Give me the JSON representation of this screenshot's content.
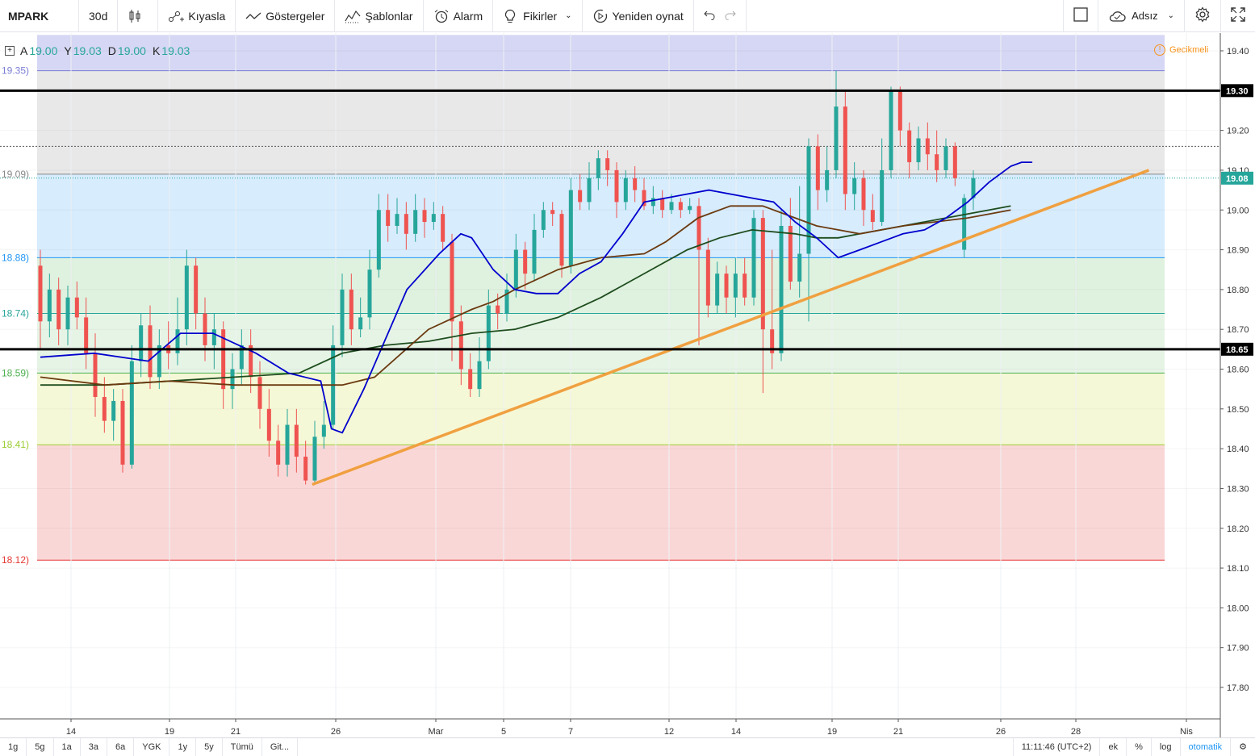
{
  "toolbar": {
    "symbol": "MPARK",
    "interval": "30d",
    "compare": "Kıyasla",
    "indicators": "Göstergeler",
    "templates": "Şablonlar",
    "alarm": "Alarm",
    "ideas": "Fikirler",
    "replay": "Yeniden oynat",
    "layout_name": "Adsız"
  },
  "legend": {
    "open_label": "A",
    "open": "19.00",
    "high_label": "Y",
    "high": "19.03",
    "low_label": "D",
    "low": "19.00",
    "close_label": "K",
    "close": "19.03",
    "delay": "Gecikmeli"
  },
  "bottombar": {
    "ranges": [
      "1g",
      "5g",
      "1a",
      "3a",
      "6a",
      "YGK",
      "1y",
      "5y",
      "Tümü",
      "Git..."
    ],
    "clock": "11:11:46 (UTC+2)",
    "toggles": [
      "ek",
      "%",
      "log",
      "otomatik"
    ]
  },
  "colors": {
    "up": "#26a69a",
    "down": "#ef5350",
    "ma_fast": "#0000cd",
    "ma_mid": "#6b3a10",
    "ma_slow": "#1e4d1e",
    "trendline": "#f0a040",
    "accent": "#2196f3"
  },
  "chart_data": {
    "type": "candlestick",
    "price_axis": {
      "ticks": [
        "19.40",
        "19.30",
        "19.20",
        "19.10",
        "19.00",
        "18.90",
        "18.80",
        "18.70",
        "18.60",
        "18.50",
        "18.40",
        "18.30",
        "18.20",
        "18.10",
        "18.00",
        "17.90",
        "17.80"
      ],
      "range": [
        17.75,
        19.45
      ]
    },
    "time_axis": {
      "ticks": [
        "14",
        "19",
        "21",
        "26",
        "Mar",
        "5",
        "7",
        "12",
        "14",
        "19",
        "21",
        "26",
        "28",
        "Nis"
      ]
    },
    "fib_levels": [
      {
        "label": "19.35)",
        "value": 19.35,
        "fill": "rgba(120,123,220,0.30)"
      },
      {
        "label": "19.09)",
        "value": 19.09,
        "fill": "rgba(150,150,150,0.22)"
      },
      {
        "label": "18.88)",
        "value": 18.88,
        "fill": "rgba(33,150,243,0.18)"
      },
      {
        "label": "18.74)",
        "value": 18.74,
        "fill": "rgba(76,175,80,0.18)"
      },
      {
        "label": "18.59)",
        "value": 18.59,
        "fill": "rgba(129,199,132,0.20)"
      },
      {
        "label": "18.41)",
        "value": 18.41,
        "fill": "rgba(205,220,57,0.20)"
      },
      {
        "label": "18.12)",
        "value": 18.12,
        "fill": "rgba(229,57,53,0.20)"
      }
    ],
    "fib_top": 19.44,
    "horizontal_lines": [
      {
        "value": 19.3,
        "label": "19.30"
      },
      {
        "value": 18.65,
        "label": "18.65"
      }
    ],
    "dotted_line": 19.16,
    "last_price": {
      "value": 19.08,
      "label": "19.08"
    },
    "trendline": {
      "from": [
        0.244,
        18.31
      ],
      "to": [
        0.986,
        19.1
      ]
    },
    "ma_fast": [
      [
        0.0,
        18.63
      ],
      [
        0.05,
        18.64
      ],
      [
        0.1,
        18.62
      ],
      [
        0.13,
        18.69
      ],
      [
        0.16,
        18.69
      ],
      [
        0.2,
        18.64
      ],
      [
        0.23,
        18.59
      ],
      [
        0.26,
        18.57
      ],
      [
        0.27,
        18.45
      ],
      [
        0.28,
        18.44
      ],
      [
        0.3,
        18.55
      ],
      [
        0.34,
        18.8
      ],
      [
        0.37,
        18.89
      ],
      [
        0.39,
        18.94
      ],
      [
        0.4,
        18.93
      ],
      [
        0.42,
        18.85
      ],
      [
        0.44,
        18.8
      ],
      [
        0.46,
        18.79
      ],
      [
        0.48,
        18.79
      ],
      [
        0.5,
        18.84
      ],
      [
        0.52,
        18.87
      ],
      [
        0.54,
        18.94
      ],
      [
        0.56,
        19.02
      ],
      [
        0.58,
        19.03
      ],
      [
        0.6,
        19.04
      ],
      [
        0.62,
        19.05
      ],
      [
        0.66,
        19.03
      ],
      [
        0.68,
        19.02
      ],
      [
        0.7,
        18.97
      ],
      [
        0.72,
        18.93
      ],
      [
        0.74,
        18.88
      ],
      [
        0.76,
        18.9
      ],
      [
        0.78,
        18.92
      ],
      [
        0.8,
        18.94
      ],
      [
        0.82,
        18.95
      ],
      [
        0.84,
        18.98
      ],
      [
        0.86,
        19.02
      ],
      [
        0.88,
        19.07
      ],
      [
        0.9,
        19.11
      ],
      [
        0.91,
        19.12
      ],
      [
        0.92,
        19.12
      ]
    ],
    "ma_mid": [
      [
        0.0,
        18.58
      ],
      [
        0.06,
        18.56
      ],
      [
        0.12,
        18.57
      ],
      [
        0.18,
        18.56
      ],
      [
        0.24,
        18.56
      ],
      [
        0.28,
        18.56
      ],
      [
        0.31,
        18.58
      ],
      [
        0.36,
        18.7
      ],
      [
        0.4,
        18.75
      ],
      [
        0.42,
        18.77
      ],
      [
        0.44,
        18.8
      ],
      [
        0.48,
        18.85
      ],
      [
        0.52,
        18.88
      ],
      [
        0.56,
        18.89
      ],
      [
        0.58,
        18.92
      ],
      [
        0.61,
        18.98
      ],
      [
        0.64,
        19.01
      ],
      [
        0.67,
        19.01
      ],
      [
        0.7,
        18.98
      ],
      [
        0.72,
        18.96
      ],
      [
        0.74,
        18.95
      ],
      [
        0.76,
        18.94
      ],
      [
        0.78,
        18.95
      ],
      [
        0.8,
        18.96
      ],
      [
        0.83,
        18.97
      ],
      [
        0.86,
        18.98
      ],
      [
        0.88,
        18.99
      ],
      [
        0.9,
        19.0
      ]
    ],
    "ma_slow": [
      [
        0.0,
        18.56
      ],
      [
        0.06,
        18.56
      ],
      [
        0.12,
        18.57
      ],
      [
        0.18,
        18.58
      ],
      [
        0.24,
        18.59
      ],
      [
        0.28,
        18.64
      ],
      [
        0.32,
        18.66
      ],
      [
        0.36,
        18.67
      ],
      [
        0.4,
        18.69
      ],
      [
        0.44,
        18.7
      ],
      [
        0.48,
        18.73
      ],
      [
        0.52,
        18.78
      ],
      [
        0.56,
        18.84
      ],
      [
        0.6,
        18.9
      ],
      [
        0.63,
        18.93
      ],
      [
        0.66,
        18.95
      ],
      [
        0.7,
        18.94
      ],
      [
        0.72,
        18.93
      ],
      [
        0.74,
        18.93
      ],
      [
        0.76,
        18.94
      ],
      [
        0.78,
        18.95
      ],
      [
        0.8,
        18.96
      ],
      [
        0.84,
        18.98
      ],
      [
        0.88,
        19.0
      ],
      [
        0.9,
        19.01
      ]
    ],
    "candles": [
      [
        18.86,
        18.72,
        18.9,
        18.65
      ],
      [
        18.72,
        18.8,
        18.84,
        18.68
      ],
      [
        18.8,
        18.7,
        18.83,
        18.66
      ],
      [
        18.7,
        18.78,
        18.81,
        18.66
      ],
      [
        18.78,
        18.73,
        18.82,
        18.7
      ],
      [
        18.73,
        18.64,
        18.78,
        18.6
      ],
      [
        18.64,
        18.53,
        18.69,
        18.48
      ],
      [
        18.53,
        18.47,
        18.58,
        18.44
      ],
      [
        18.47,
        18.52,
        18.55,
        18.42
      ],
      [
        18.52,
        18.36,
        18.55,
        18.34
      ],
      [
        18.36,
        18.62,
        18.66,
        18.35
      ],
      [
        18.62,
        18.71,
        18.74,
        18.58
      ],
      [
        18.71,
        18.58,
        18.76,
        18.55
      ],
      [
        18.58,
        18.66,
        18.7,
        18.55
      ],
      [
        18.66,
        18.64,
        18.72,
        18.6
      ],
      [
        18.64,
        18.7,
        18.78,
        18.61
      ],
      [
        18.7,
        18.86,
        18.9,
        18.66
      ],
      [
        18.86,
        18.74,
        18.88,
        18.7
      ],
      [
        18.74,
        18.66,
        18.78,
        18.62
      ],
      [
        18.66,
        18.7,
        18.74,
        18.6
      ],
      [
        18.7,
        18.55,
        18.72,
        18.5
      ],
      [
        18.55,
        18.6,
        18.64,
        18.5
      ],
      [
        18.6,
        18.66,
        18.7,
        18.56
      ],
      [
        18.66,
        18.58,
        18.7,
        18.54
      ],
      [
        18.58,
        18.5,
        18.62,
        18.45
      ],
      [
        18.5,
        18.42,
        18.55,
        18.38
      ],
      [
        18.42,
        18.36,
        18.46,
        18.33
      ],
      [
        18.36,
        18.46,
        18.5,
        18.33
      ],
      [
        18.46,
        18.38,
        18.5,
        18.34
      ],
      [
        18.38,
        18.32,
        18.42,
        18.31
      ],
      [
        18.32,
        18.43,
        18.47,
        18.31
      ],
      [
        18.43,
        18.46,
        18.52,
        18.4
      ],
      [
        18.46,
        18.66,
        18.71,
        18.45
      ],
      [
        18.66,
        18.8,
        18.84,
        18.63
      ],
      [
        18.8,
        18.7,
        18.84,
        18.66
      ],
      [
        18.7,
        18.73,
        18.78,
        18.68
      ],
      [
        18.73,
        18.85,
        18.9,
        18.7
      ],
      [
        18.85,
        19.0,
        19.04,
        18.83
      ],
      [
        19.0,
        18.96,
        19.04,
        18.92
      ],
      [
        18.96,
        18.99,
        19.03,
        18.94
      ],
      [
        18.99,
        18.94,
        19.02,
        18.9
      ],
      [
        18.94,
        19.0,
        19.04,
        18.92
      ],
      [
        19.0,
        18.97,
        19.03,
        18.93
      ],
      [
        18.97,
        18.99,
        19.02,
        18.95
      ],
      [
        18.99,
        18.92,
        19.01,
        18.9
      ],
      [
        18.92,
        18.72,
        18.94,
        18.62
      ],
      [
        18.72,
        18.6,
        18.76,
        18.56
      ],
      [
        18.6,
        18.55,
        18.64,
        18.53
      ],
      [
        18.55,
        18.62,
        18.68,
        18.53
      ],
      [
        18.62,
        18.76,
        18.8,
        18.6
      ],
      [
        18.76,
        18.74,
        18.79,
        18.7
      ],
      [
        18.74,
        18.8,
        18.84,
        18.72
      ],
      [
        18.8,
        18.9,
        18.94,
        18.78
      ],
      [
        18.9,
        18.84,
        18.92,
        18.8
      ],
      [
        18.84,
        18.95,
        18.99,
        18.82
      ],
      [
        18.95,
        19.0,
        19.02,
        18.93
      ],
      [
        19.0,
        18.99,
        19.02,
        18.96
      ],
      [
        18.99,
        18.86,
        19.0,
        18.83
      ],
      [
        18.86,
        19.05,
        19.08,
        18.84
      ],
      [
        19.05,
        19.02,
        19.09,
        19.0
      ],
      [
        19.02,
        19.08,
        19.12,
        19.0
      ],
      [
        19.08,
        19.13,
        19.15,
        19.05
      ],
      [
        19.13,
        19.1,
        19.15,
        19.06
      ],
      [
        19.1,
        19.02,
        19.12,
        18.98
      ],
      [
        19.02,
        19.08,
        19.1,
        19.0
      ],
      [
        19.08,
        19.05,
        19.11,
        19.02
      ],
      [
        19.05,
        19.01,
        19.08,
        19.0
      ],
      [
        19.01,
        19.03,
        19.06,
        18.99
      ],
      [
        19.03,
        19.0,
        19.05,
        18.98
      ],
      [
        19.0,
        19.02,
        19.04,
        18.99
      ],
      [
        19.02,
        19.0,
        19.03,
        18.98
      ],
      [
        19.0,
        19.01,
        19.03,
        18.99
      ],
      [
        19.01,
        18.9,
        19.03,
        18.66
      ],
      [
        18.9,
        18.76,
        18.93,
        18.73
      ],
      [
        18.76,
        18.84,
        18.87,
        18.74
      ],
      [
        18.84,
        18.78,
        18.86,
        18.74
      ],
      [
        18.78,
        18.84,
        18.88,
        18.73
      ],
      [
        18.84,
        18.78,
        18.88,
        18.76
      ],
      [
        18.78,
        18.98,
        19.0,
        18.76
      ],
      [
        18.98,
        18.7,
        19.0,
        18.54
      ],
      [
        18.7,
        18.64,
        18.9,
        18.6
      ],
      [
        18.64,
        18.96,
        19.0,
        18.62
      ],
      [
        18.96,
        18.82,
        19.03,
        18.8
      ],
      [
        18.82,
        18.89,
        19.06,
        18.78
      ],
      [
        18.89,
        19.16,
        19.18,
        18.72
      ],
      [
        19.16,
        19.05,
        19.19,
        19.0
      ],
      [
        19.05,
        19.1,
        19.16,
        19.02
      ],
      [
        19.1,
        19.26,
        19.35,
        19.08
      ],
      [
        19.26,
        19.04,
        19.3,
        19.0
      ],
      [
        19.04,
        19.08,
        19.12,
        19.0
      ],
      [
        19.08,
        19.0,
        19.1,
        18.96
      ],
      [
        19.0,
        18.97,
        19.04,
        18.95
      ],
      [
        18.97,
        19.1,
        19.18,
        18.96
      ],
      [
        19.1,
        19.3,
        19.31,
        19.08
      ],
      [
        19.3,
        19.2,
        19.31,
        19.16
      ],
      [
        19.2,
        19.12,
        19.22,
        19.08
      ],
      [
        19.12,
        19.18,
        19.21,
        19.1
      ],
      [
        19.18,
        19.14,
        19.22,
        19.1
      ],
      [
        19.14,
        19.1,
        19.2,
        19.07
      ],
      [
        19.1,
        19.16,
        19.18,
        19.08
      ],
      [
        19.16,
        19.08,
        19.17,
        19.06
      ],
      [
        18.9,
        19.03,
        19.04,
        18.88
      ],
      [
        19.03,
        19.08,
        19.1,
        19.0
      ]
    ]
  }
}
